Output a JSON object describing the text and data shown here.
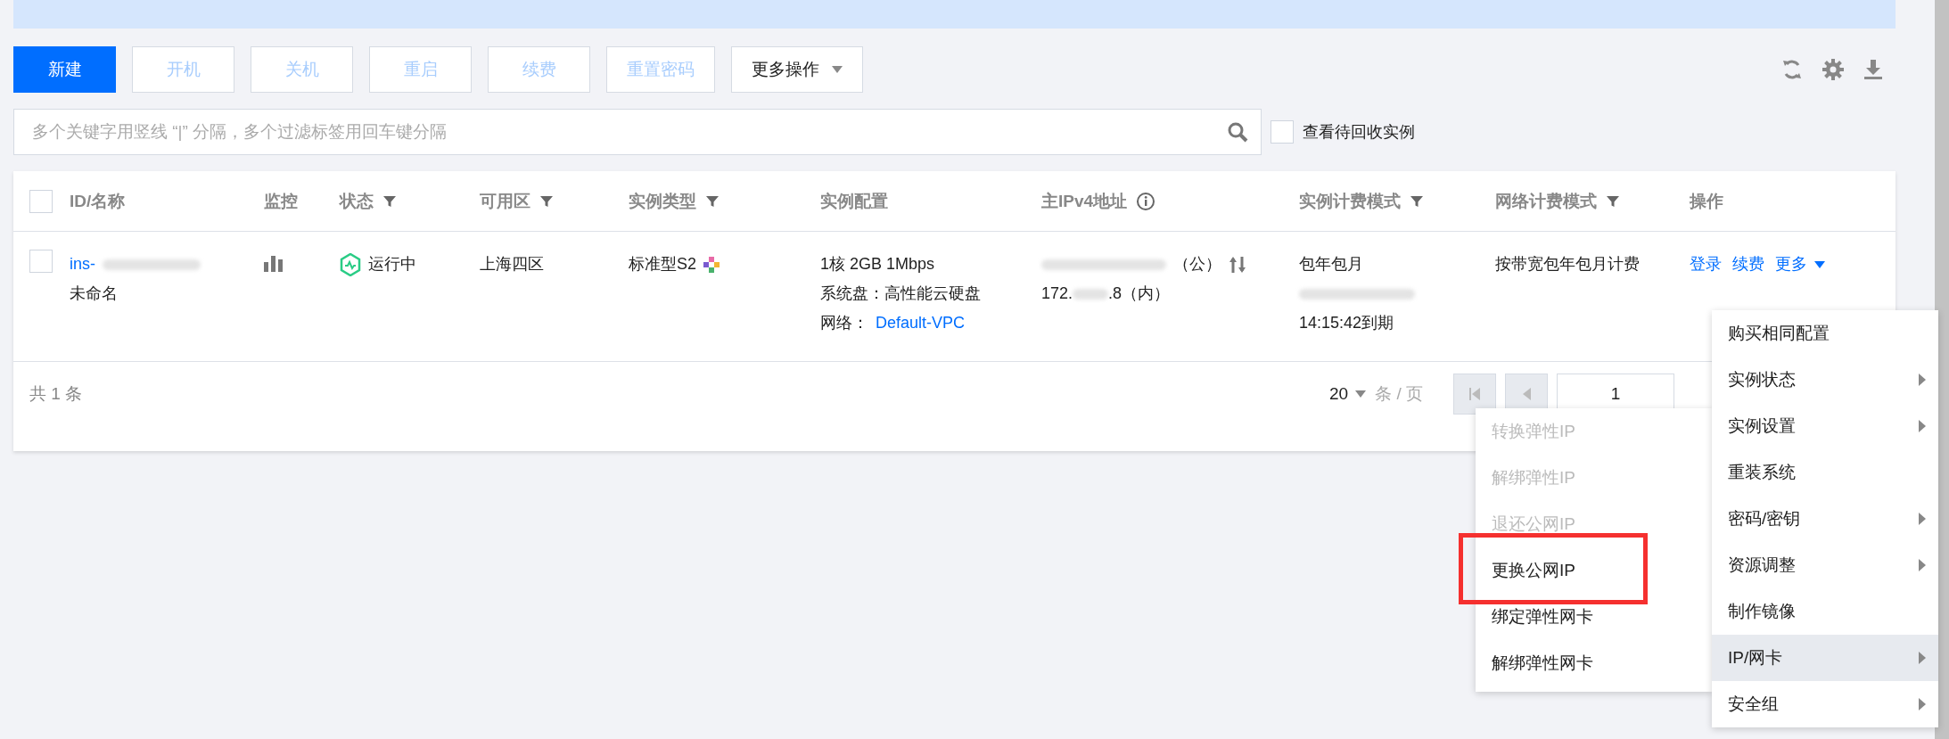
{
  "toolbar": {
    "buttons": [
      {
        "label": "新建",
        "kind": "primary",
        "disabled": false
      },
      {
        "label": "开机",
        "kind": "plain",
        "disabled": true
      },
      {
        "label": "关机",
        "kind": "plain",
        "disabled": true
      },
      {
        "label": "重启",
        "kind": "plain",
        "disabled": true
      },
      {
        "label": "续费",
        "kind": "plain",
        "disabled": true
      },
      {
        "label": "重置密码",
        "kind": "plain",
        "disabled": true
      },
      {
        "label": "更多操作",
        "kind": "dropdown",
        "disabled": false
      }
    ]
  },
  "search": {
    "placeholder": "多个关键字用竖线 “|” 分隔，多个过滤标签用回车键分隔"
  },
  "recycle_filter": {
    "label": "查看待回收实例",
    "checked": false
  },
  "table": {
    "select_all_checked": false,
    "columns": [
      {
        "label": "ID/名称",
        "kind": "plain"
      },
      {
        "label": "监控",
        "kind": "plain"
      },
      {
        "label": "状态",
        "kind": "filter"
      },
      {
        "label": "可用区",
        "kind": "filter"
      },
      {
        "label": "实例类型",
        "kind": "filter"
      },
      {
        "label": "实例配置",
        "kind": "plain"
      },
      {
        "label": "主IPv4地址",
        "kind": "info"
      },
      {
        "label": "实例计费模式",
        "kind": "filter"
      },
      {
        "label": "网络计费模式",
        "kind": "filter"
      },
      {
        "label": "操作",
        "kind": "plain"
      }
    ],
    "rows": [
      {
        "selected": false,
        "id_head": "ins-",
        "name": "未命名",
        "status": "运行中",
        "zone": "上海四区",
        "type": "标准型S2",
        "config": [
          "1核 2GB 1Mbps",
          "系统盘：高性能云硬盘"
        ],
        "network_label": "网络：",
        "network": "Default-VPC",
        "ip_public_tail": "（公）",
        "ip_private_head": "172.",
        "ip_private_tail": ".8（内）",
        "billing": "包年包月",
        "expiry": "14:15:42到期",
        "net_billing": "按带宽包年包月计费",
        "actions": [
          "登录",
          "续费",
          "更多"
        ]
      }
    ]
  },
  "footer": {
    "total": "共 1 条",
    "page_size": "20",
    "per_page": "条 / 页",
    "page": "1"
  },
  "context_menu": {
    "items": [
      {
        "label": "购买相同配置",
        "submenu": false,
        "selected": false
      },
      {
        "label": "实例状态",
        "submenu": true,
        "selected": false
      },
      {
        "label": "实例设置",
        "submenu": true,
        "selected": false
      },
      {
        "label": "重装系统",
        "submenu": false,
        "selected": false
      },
      {
        "label": "密码/密钥",
        "submenu": true,
        "selected": false
      },
      {
        "label": "资源调整",
        "submenu": true,
        "selected": false
      },
      {
        "label": "制作镜像",
        "submenu": false,
        "selected": false
      },
      {
        "label": "IP/网卡",
        "submenu": true,
        "selected": true
      },
      {
        "label": "安全组",
        "submenu": true,
        "selected": false
      }
    ]
  },
  "submenu": {
    "items": [
      {
        "label": "转换弹性IP",
        "disabled": true,
        "highlighted": false
      },
      {
        "label": "解绑弹性IP",
        "disabled": true,
        "highlighted": false
      },
      {
        "label": "退还公网IP",
        "disabled": true,
        "highlighted": false
      },
      {
        "label": "更换公网IP",
        "disabled": false,
        "highlighted": true
      },
      {
        "label": "绑定弹性网卡",
        "disabled": false,
        "highlighted": false
      },
      {
        "label": "解绑弹性网卡",
        "disabled": false,
        "highlighted": false
      }
    ]
  }
}
